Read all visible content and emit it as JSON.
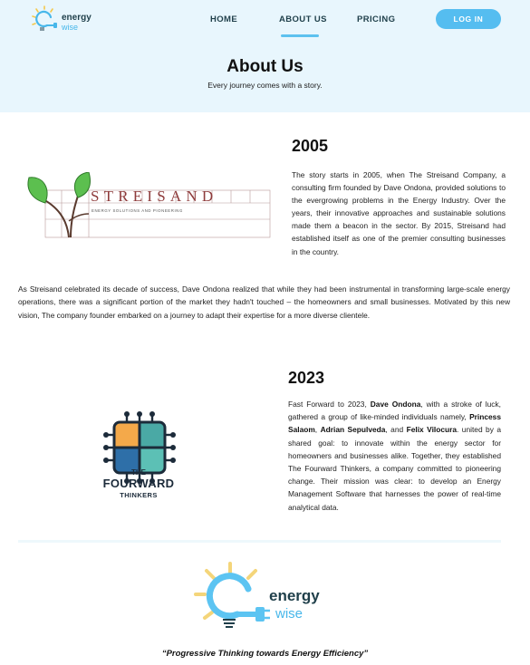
{
  "brand": {
    "name_line1": "energy",
    "name_line2": "wise"
  },
  "nav": {
    "items": [
      {
        "label": "HOME"
      },
      {
        "label": "ABOUT US"
      },
      {
        "label": "PRICING"
      }
    ],
    "login_label": "LOG IN"
  },
  "hero": {
    "title": "About Us",
    "subtitle": "Every journey comes with a story."
  },
  "section_2005": {
    "year": "2005",
    "logo": {
      "name": "STREISAND",
      "tagline": "ENERGY SOLUTIONS AND PIONEERING"
    },
    "paragraph": "The story starts in 2005, when The Streisand Company, a consulting firm founded by Dave Ondona, provided solutions to the evergrowing problems in the Energy Industry. Over the years, their innovative approaches and sustainable solutions made them a beacon in the sector. By 2015, Streisand had established itself as one of the premier consulting businesses in the country."
  },
  "bridge": {
    "paragraph": "As Streisand celebrated its decade of success, Dave Ondona realized that while they had been instrumental in transforming large-scale energy operations, there was a significant portion of the market they hadn't touched – the homeowners and small businesses. Motivated by this new vision, The company founder embarked on a journey to adapt their expertise for a more diverse clientele."
  },
  "section_2023": {
    "year": "2023",
    "logo": {
      "the": "THE",
      "name": "FOURWARD",
      "sub": "THINKERS"
    },
    "p1": "Fast Forward to 2023, ",
    "b1": "Dave Ondona",
    "p2": ", with a stroke of luck, gathered a group of like-minded individuals namely, ",
    "b2": "Princess Salaom",
    "p3": ", ",
    "b3": "Adrian Sepulveda",
    "p4": ", and ",
    "b4": "Felix Vilocura",
    "p5": ". united by a shared goal: to innovate within the energy sector for homeowners and businesses alike. Together, they established The Fourward Thinkers, a company committed to pioneering change. Their mission was clear: to develop an Energy Management Software that harnesses the power of real-time analytical data."
  },
  "footer": {
    "brand_line1": "energy",
    "brand_line2": "wise",
    "tagline": "“Progressive Thinking towards Energy Efficiency”"
  },
  "colors": {
    "accent": "#55bdf0",
    "header_bg": "#e8f6fd",
    "dark": "#1f3f4a",
    "leaf_green": "#5cbf4f",
    "streisand_red": "#8e3b3b"
  },
  "icons": {
    "brand": "bulb-plug-icon",
    "streisand": "sprout-logo",
    "fourward": "grid-circuit-logo"
  }
}
